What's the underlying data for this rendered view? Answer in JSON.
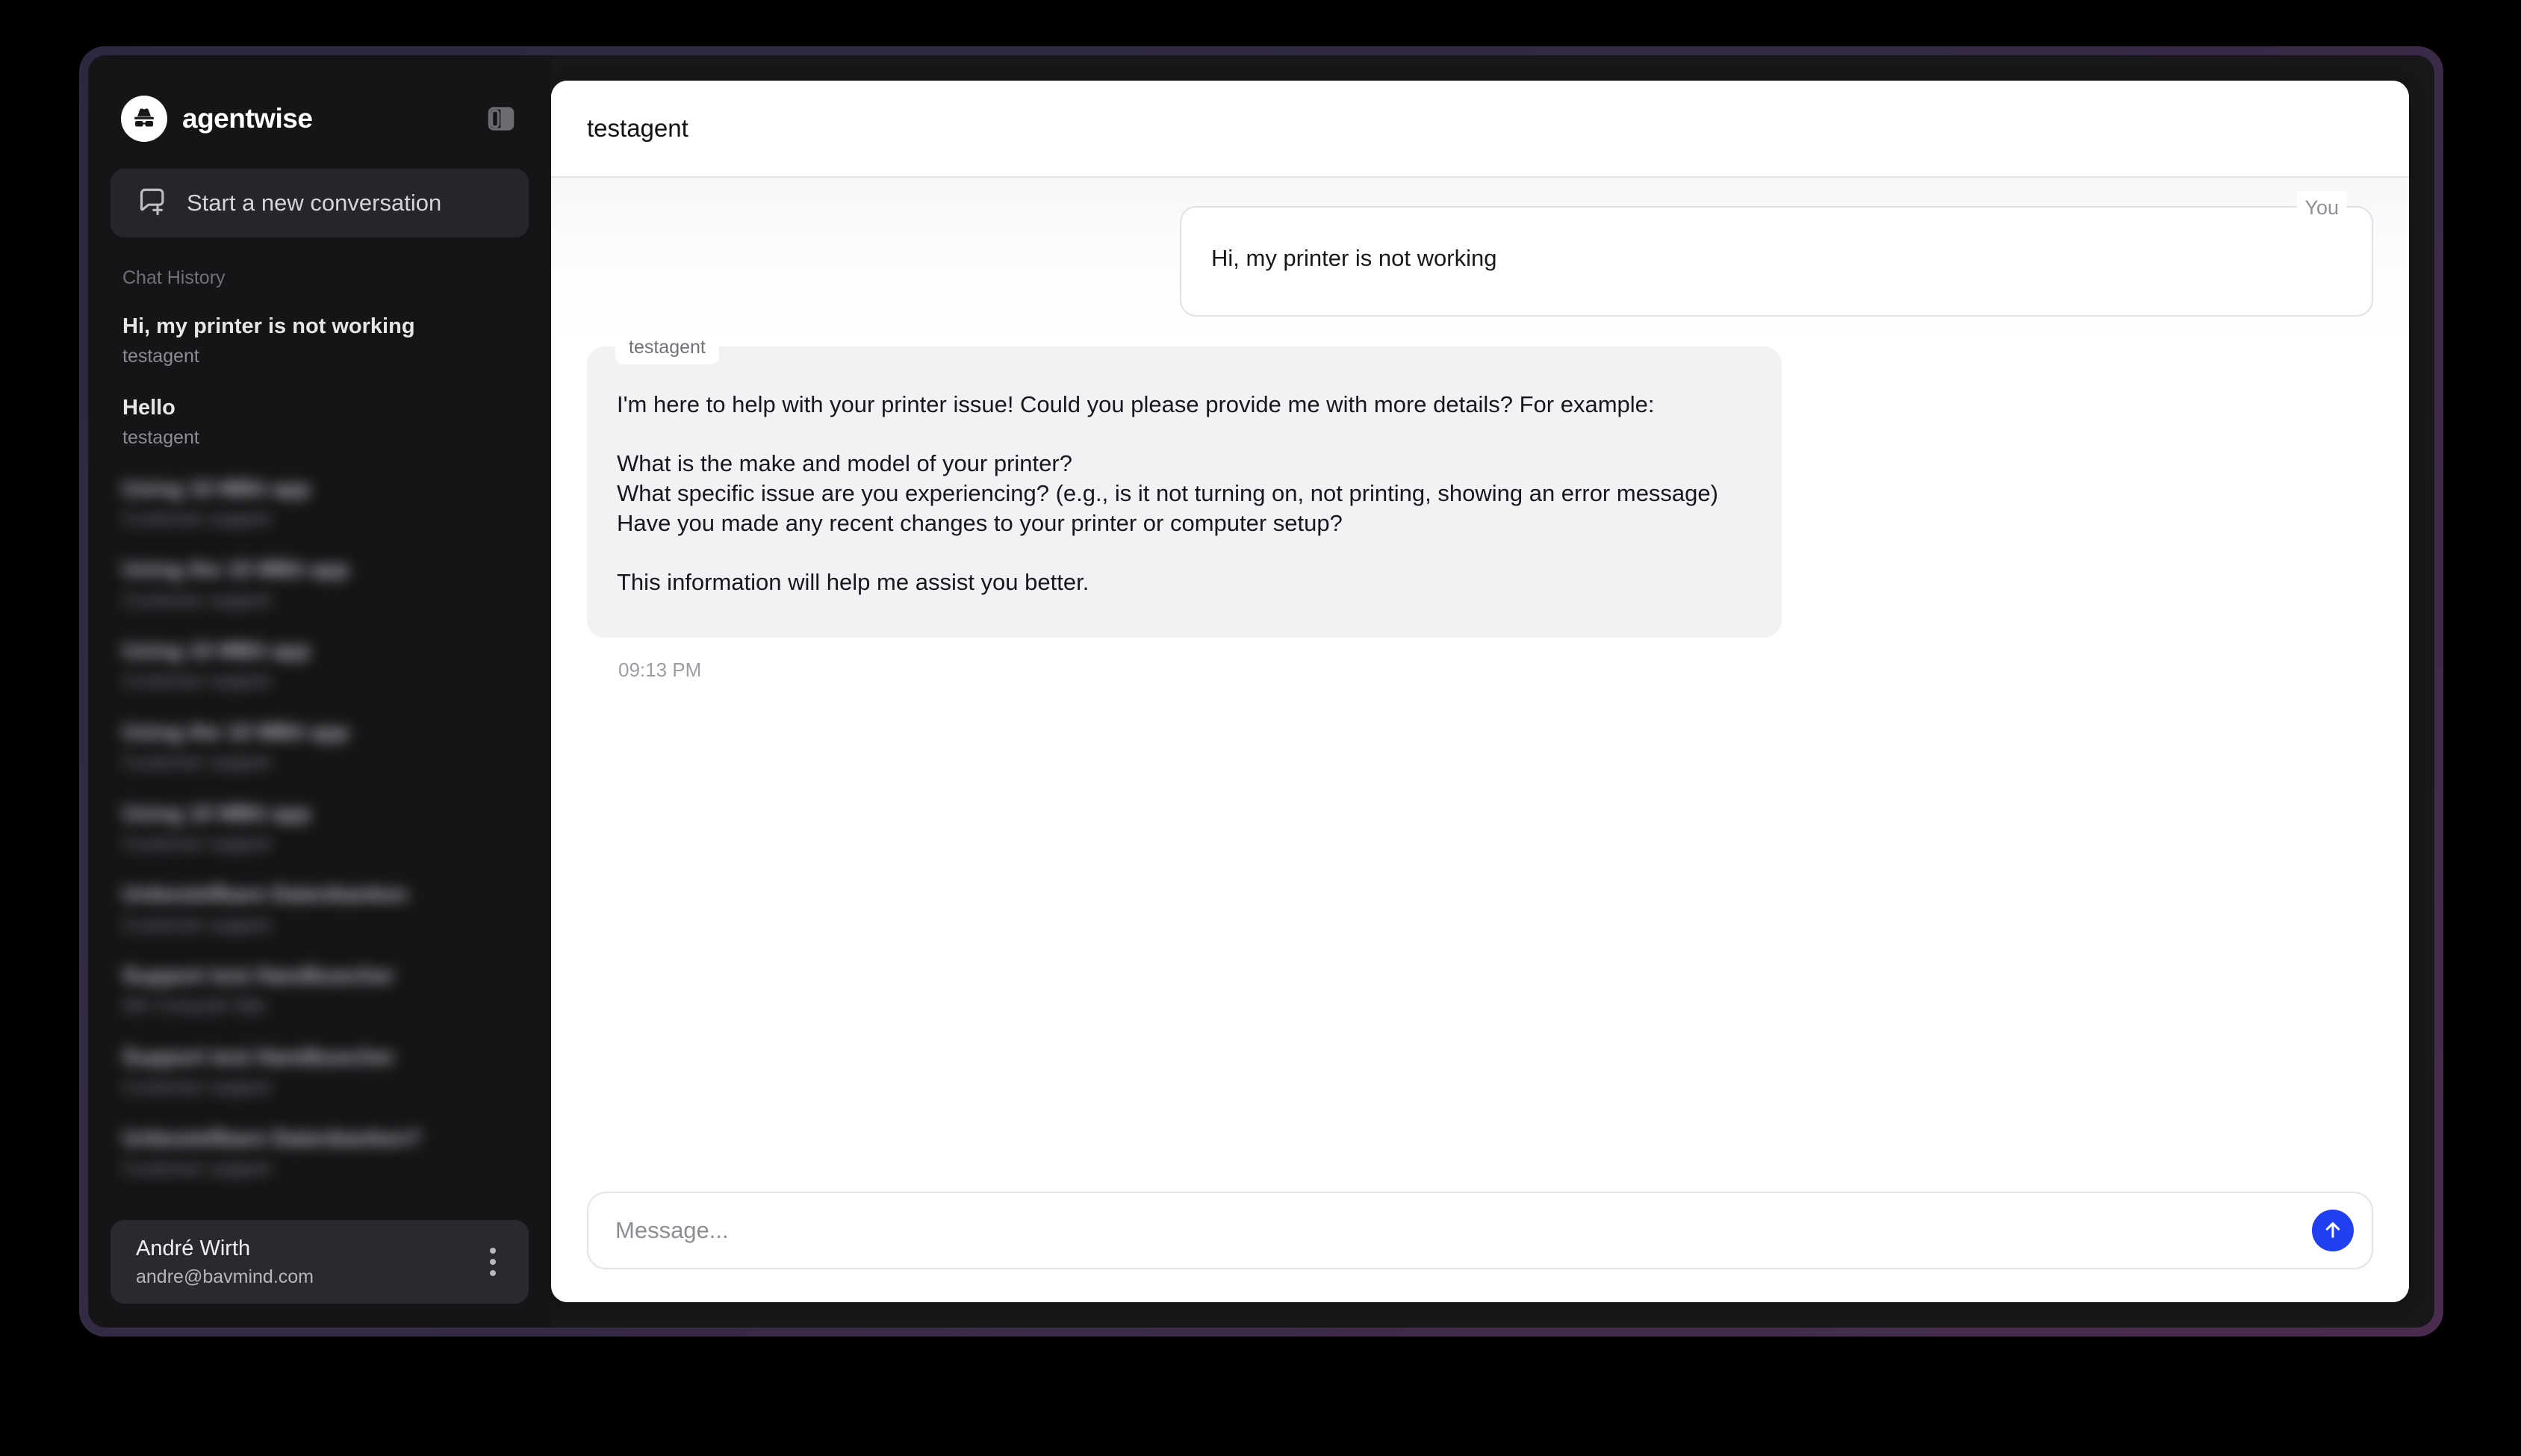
{
  "theme": {
    "frame_gradient_start": "#2b2940",
    "frame_gradient_end": "#4a2c4e",
    "app_background": "#18181b",
    "sidebar_background": "#151517",
    "accent_send": "#1f3ff0",
    "agent_bubble": "#f1f2f3"
  },
  "sidebar": {
    "brand": {
      "name": "agentwise",
      "logo_icon": "incognito-avatar-icon"
    },
    "panel_toggle_icon": "sidebar-panel-toggle-icon",
    "new_conversation": {
      "label": "Start a new conversation",
      "icon": "message-square-plus-icon"
    },
    "history_heading": "Chat History",
    "history": [
      {
        "title": "Hi, my printer is not working",
        "subtitle": "testagent",
        "blurred": false
      },
      {
        "title": "Hello",
        "subtitle": "testagent",
        "blurred": false
      },
      {
        "title": "Using 10 MBit app",
        "subtitle": "Customer support",
        "blurred": true
      },
      {
        "title": "Using the 10 MBit app",
        "subtitle": "Customer support",
        "blurred": true
      },
      {
        "title": "Using 10 MBit app",
        "subtitle": "Customer support",
        "blurred": true
      },
      {
        "title": "Using the 10 MBit app",
        "subtitle": "Customer support",
        "blurred": true
      },
      {
        "title": "Using 10 MBit app",
        "subtitle": "Customer support",
        "blurred": true
      },
      {
        "title": "Unbestellbare Datenbanken",
        "subtitle": "Customer support",
        "blurred": true
      },
      {
        "title": "Support test Handbuecher",
        "subtitle": "Wir Crewzeit Site",
        "blurred": true
      },
      {
        "title": "Support test Handbuecher",
        "subtitle": "Customer support",
        "blurred": true
      },
      {
        "title": "Unbestellbare Datenbanken?",
        "subtitle": "Customer support",
        "blurred": true
      }
    ],
    "user": {
      "name": "André Wirth",
      "email": "andre@bavmind.com",
      "menu_icon": "kebab-menu-icon"
    }
  },
  "chat": {
    "title": "testagent",
    "messages": [
      {
        "role": "user",
        "author_label": "You",
        "text": "Hi, my printer is not working"
      },
      {
        "role": "agent",
        "author_label": "testagent",
        "text": "I'm here to help with your printer issue! Could you please provide me with more details? For example:\n\nWhat is the make and model of your printer?\nWhat specific issue are you experiencing? (e.g., is it not turning on, not printing, showing an error message)\nHave you made any recent changes to your printer or computer setup?\n\nThis information will help me assist you better.",
        "time": "09:13 PM"
      }
    ]
  },
  "composer": {
    "placeholder": "Message...",
    "value": "",
    "send_icon": "arrow-up-icon"
  }
}
